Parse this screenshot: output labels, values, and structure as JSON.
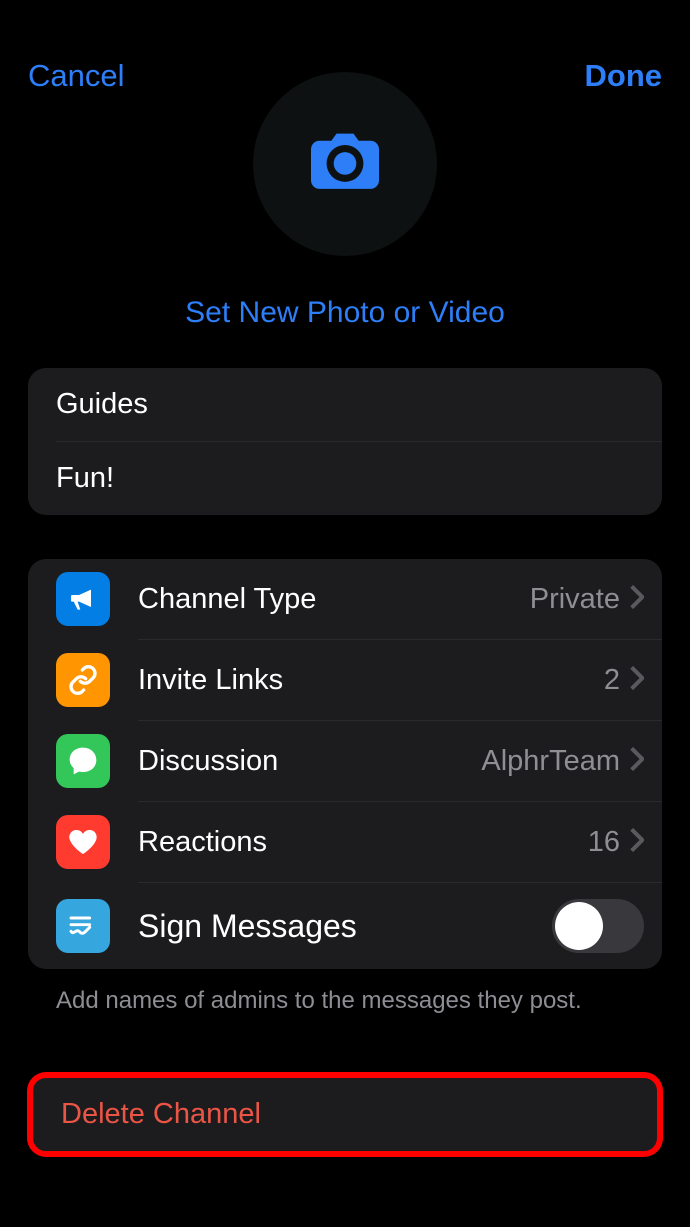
{
  "header": {
    "cancel": "Cancel",
    "done": "Done"
  },
  "avatar": {
    "set_photo_label": "Set New Photo or Video"
  },
  "info": {
    "name": "Guides",
    "description": "Fun!"
  },
  "settings": {
    "channel_type": {
      "label": "Channel Type",
      "value": "Private"
    },
    "invite_links": {
      "label": "Invite Links",
      "value": "2"
    },
    "discussion": {
      "label": "Discussion",
      "value": "AlphrTeam"
    },
    "reactions": {
      "label": "Reactions",
      "value": "16"
    },
    "sign_messages": {
      "label": "Sign Messages"
    },
    "footer_hint": "Add names of admins to the messages they post."
  },
  "delete": {
    "label": "Delete Channel"
  }
}
